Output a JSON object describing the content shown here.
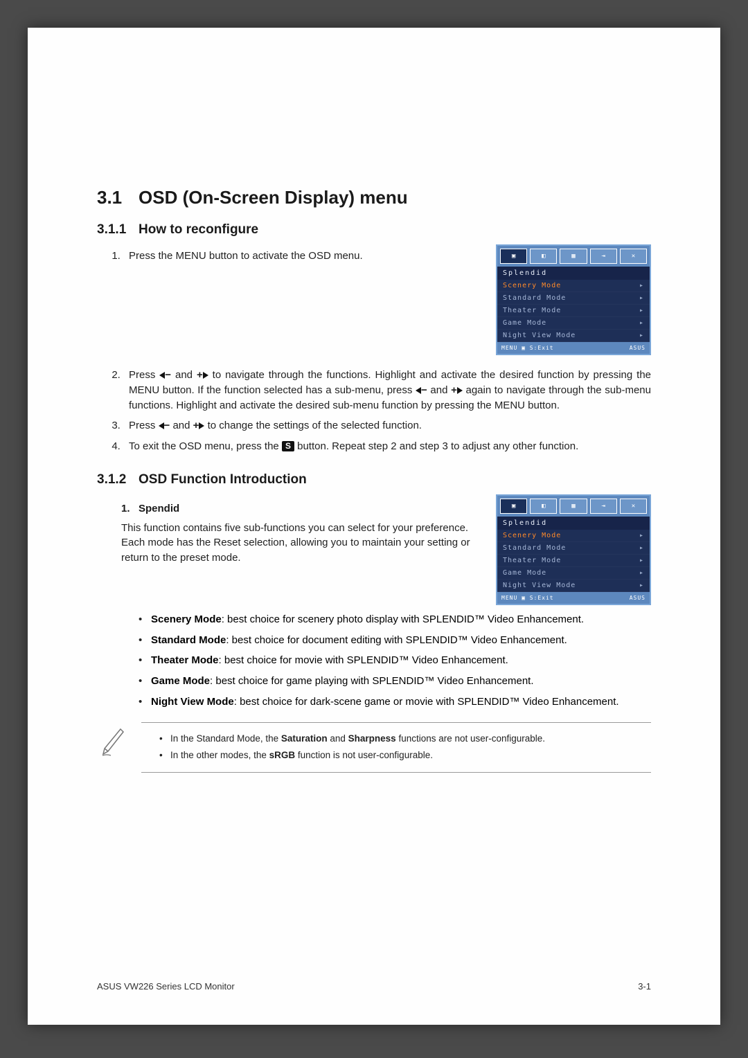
{
  "section": {
    "number": "3.1",
    "title": "OSD (On-Screen Display) menu"
  },
  "sub1": {
    "number": "3.1.1",
    "title": "How to reconfigure",
    "steps": {
      "s1": "Press the MENU button to activate the OSD menu.",
      "s2a": "Press ",
      "s2b": " and ",
      "s2c": " to navigate through the functions. Highlight and activate the desired function by pressing the MENU button. If the function selected has a sub-menu, press ",
      "s2d": " and ",
      "s2e": " again to navigate through the sub-menu functions. Highlight and activate the desired sub-menu function by pressing the MENU button.",
      "s3a": "Press ",
      "s3b": " and ",
      "s3c": " to change the settings of the selected function.",
      "s4a": "To exit the OSD menu, press the ",
      "s4b": " button. Repeat step 2 and step 3 to adjust any other function."
    }
  },
  "sub2": {
    "number": "3.1.2",
    "title": "OSD Function Introduction",
    "spendid_heading": "1.   Spendid",
    "spendid_para": "This function contains five sub-functions you can select for your preference. Each mode has the Reset selection, allowing you to maintain your setting or return to the preset mode.",
    "bullets": {
      "b1_bold": "Scenery Mode",
      "b1_rest": ": best choice for scenery photo display with SPLENDID™ Video Enhancement.",
      "b2_bold": "Standard Mode",
      "b2_rest": ": best choice for document editing with SPLENDID™ Video Enhancement.",
      "b3_bold": "Theater Mode",
      "b3_rest": ": best choice for movie with SPLENDID™ Video Enhancement.",
      "b4_bold": "Game Mode",
      "b4_rest": ": best choice for game playing with SPLENDID™ Video Enhancement.",
      "b5_bold": "Night View Mode",
      "b5_rest": ": best choice for dark-scene game or movie with SPLENDID™ Video Enhancement."
    },
    "note": {
      "n1a": "In the Standard Mode, the ",
      "n1b": "Saturation",
      "n1c": " and ",
      "n1d": "Sharpness",
      "n1e": " functions are not user-configurable.",
      "n2a": "In the other modes, the ",
      "n2b": "sRGB",
      "n2c": " function is not user-configurable."
    }
  },
  "osd": {
    "heading": "Splendid",
    "items": [
      "Scenery Mode",
      "Standard Mode",
      "Theater Mode",
      "Game Mode",
      "Night View Mode"
    ],
    "footer_left": "MENU ▣  S:Exit",
    "brand": "ASUS"
  },
  "footer": {
    "left": "ASUS VW226 Series LCD Monitor",
    "right": "3-1"
  },
  "symbols": {
    "minus": "−",
    "plus": "+",
    "s": "S"
  }
}
